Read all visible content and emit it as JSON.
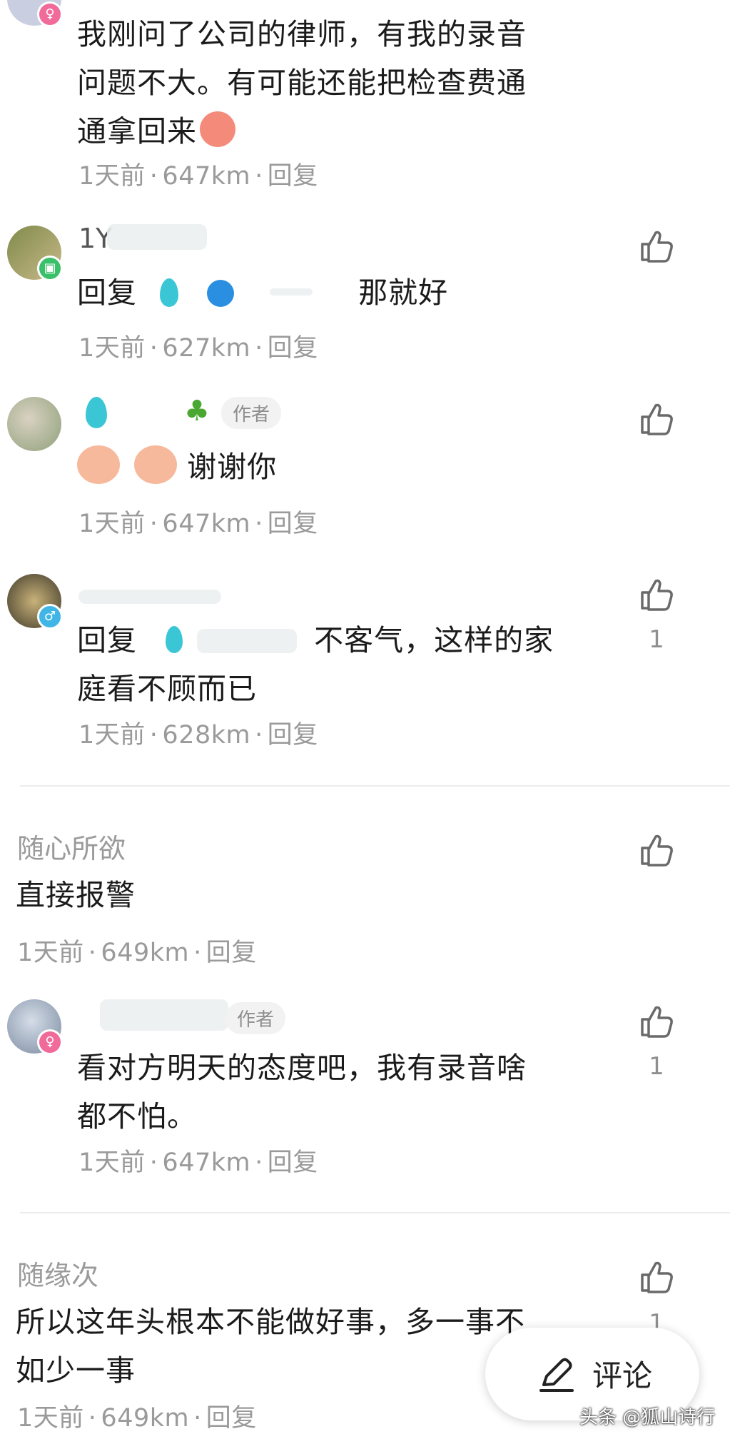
{
  "comments": [
    {
      "text_lines": [
        "我刚问了公司的律师，有我的录音",
        "问题不大。有可能还能把检查费通",
        "通拿回来"
      ],
      "time": "1天前",
      "distance": "647km",
      "reply": "回复"
    },
    {
      "username": "1Y",
      "reply_prefix": "回复",
      "text": "那就好",
      "time": "1天前",
      "distance": "627km",
      "reply": "回复"
    },
    {
      "author_tag": "作者",
      "text": "谢谢你",
      "time": "1天前",
      "distance": "647km",
      "reply": "回复"
    },
    {
      "reply_prefix": "回复",
      "text_lines": [
        "不客气，这样的家",
        "庭看不顾而已"
      ],
      "like_count": "1",
      "time": "1天前",
      "distance": "628km",
      "reply": "回复"
    },
    {
      "username": "随心所欲",
      "text": "直接报警",
      "time": "1天前",
      "distance": "649km",
      "reply": "回复"
    },
    {
      "author_tag": "作者",
      "text_lines": [
        "看对方明天的态度吧，我有录音啥",
        "都不怕。"
      ],
      "like_count": "1",
      "time": "1天前",
      "distance": "647km",
      "reply": "回复"
    },
    {
      "username": "随缘次",
      "text_lines": [
        "所以这年头根本不能做好事，多一事不",
        "如少一事"
      ],
      "like_count": "1",
      "time": "1天前",
      "distance": "649km",
      "reply": "回复"
    }
  ],
  "comment_button": {
    "label": "评论",
    "icon": "pen-icon"
  },
  "watermark": "头条 @狐山诗行",
  "colors": {
    "text": "#1b1b1b",
    "meta": "#9a9a9a",
    "female_badge": "#f06a9a",
    "male_badge": "#3fb6e6"
  }
}
